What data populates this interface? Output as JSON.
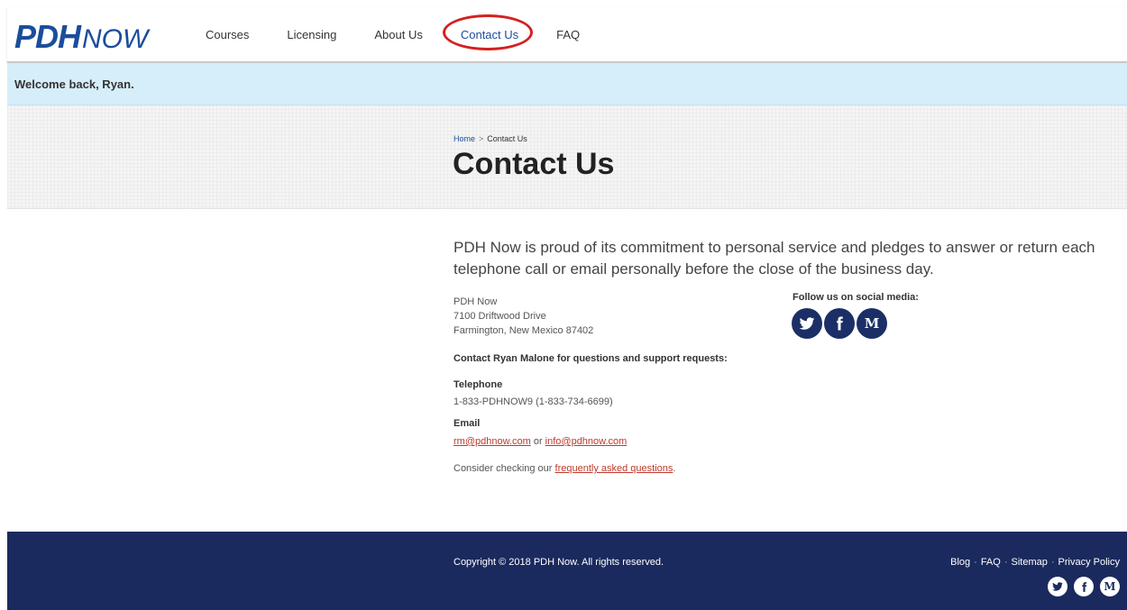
{
  "brand": {
    "logo_bold": "PDH",
    "logo_light": "NOW"
  },
  "nav": {
    "items": [
      {
        "label": "Courses"
      },
      {
        "label": "Licensing"
      },
      {
        "label": "About Us"
      },
      {
        "label": "Contact Us",
        "active": true
      },
      {
        "label": "FAQ"
      }
    ]
  },
  "welcome": {
    "text": "Welcome back, Ryan."
  },
  "breadcrumb": {
    "home": "Home",
    "separator": ">",
    "current": "Contact Us"
  },
  "page": {
    "title": "Contact Us"
  },
  "content": {
    "intro": "PDH Now is proud of its commitment to personal service and pledges to answer or return each telephone call or email personally before the close of the business day.",
    "address": [
      "PDH Now",
      "7100 Driftwood Drive",
      "Farmington, New Mexico 87402"
    ],
    "contact_person": "Contact Ryan Malone for questions and support requests:",
    "telephone_label": "Telephone",
    "telephone_value": "1-833-PDHNOW9 (1-833-734-6699)",
    "email_label": "Email",
    "email_primary": "rm@pdhnow.com",
    "email_or": " or ",
    "email_secondary": "info@pdhnow.com",
    "faq_prefix": "Consider checking our ",
    "faq_link": "frequently asked questions",
    "faq_suffix": "."
  },
  "social": {
    "label": "Follow us on social media:",
    "icons": [
      "twitter-icon",
      "facebook-icon",
      "medium-icon"
    ]
  },
  "footer": {
    "copyright": "Copyright © 2018 PDH Now. All rights reserved.",
    "links": [
      "Blog",
      "FAQ",
      "Sitemap",
      "Privacy Policy"
    ],
    "separator": "·"
  },
  "colors": {
    "brand_blue": "#1b4d9b",
    "footer_navy": "#1a2a5e",
    "welcome_bg": "#d6eef9",
    "link_red": "#c0392b",
    "highlight_circle": "#d42020"
  }
}
